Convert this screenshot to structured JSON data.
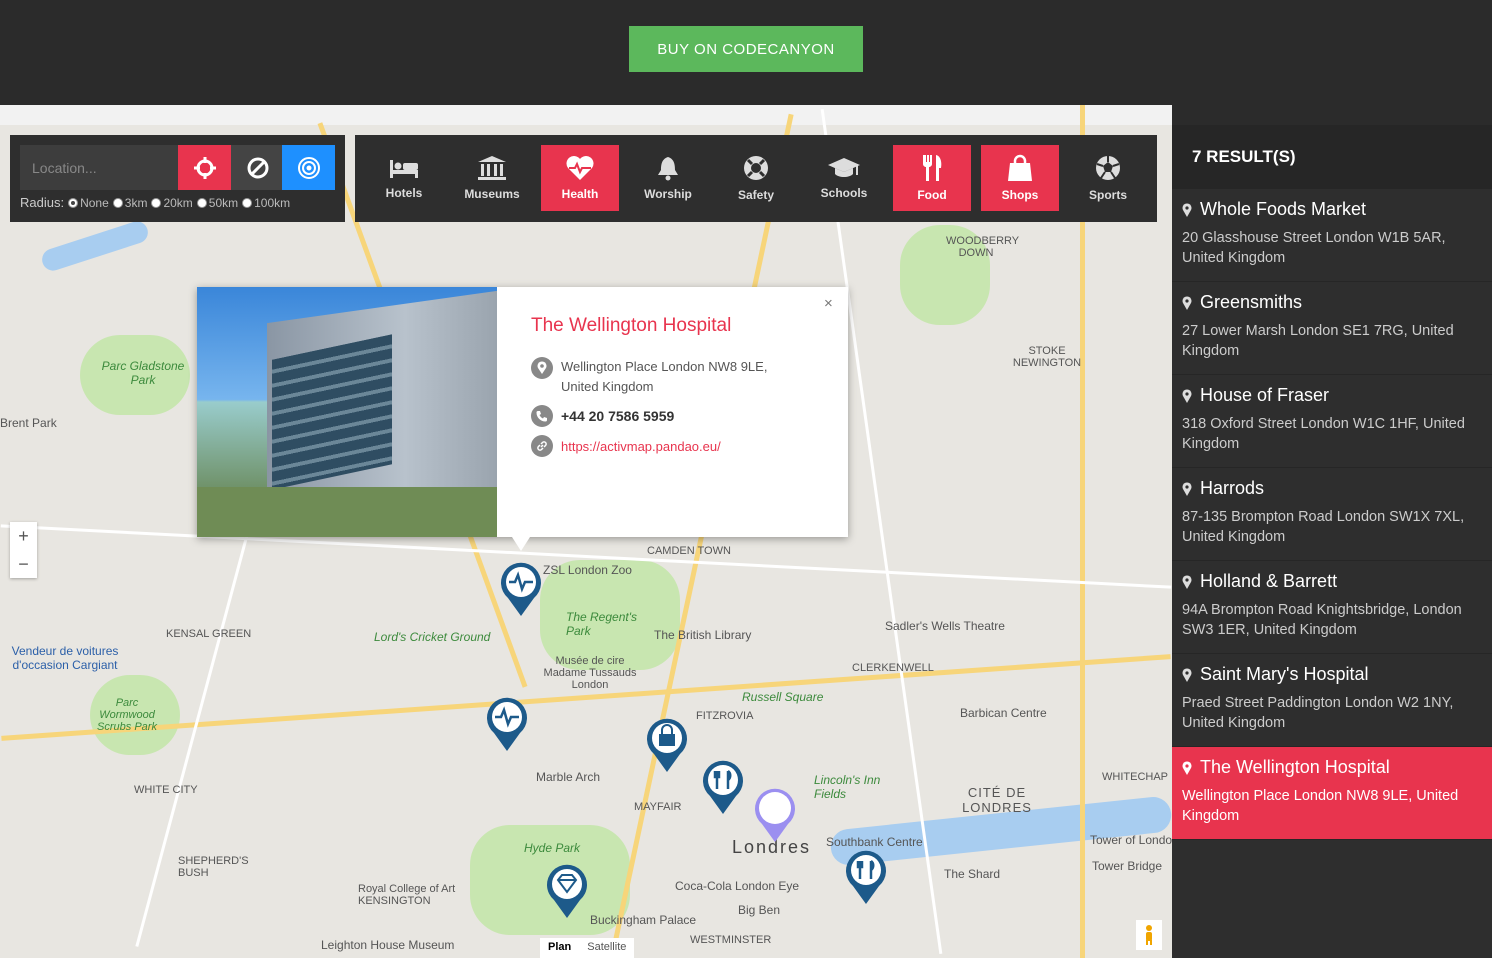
{
  "header": {
    "buy_label": "BUY ON CODECANYON"
  },
  "location": {
    "placeholder": "Location...",
    "radius_label": "Radius:",
    "radius_options": [
      "None",
      "3km",
      "20km",
      "50km",
      "100km"
    ]
  },
  "categories": [
    {
      "label": "Hotels",
      "icon": "bed-icon",
      "active": false
    },
    {
      "label": "Museums",
      "icon": "museum-icon",
      "active": false
    },
    {
      "label": "Health",
      "icon": "heartbeat-icon",
      "active": true
    },
    {
      "label": "Worship",
      "icon": "bell-icon",
      "active": false
    },
    {
      "label": "Safety",
      "icon": "lifebuoy-icon",
      "active": false
    },
    {
      "label": "Schools",
      "icon": "graduation-cap-icon",
      "active": false
    },
    {
      "label": "Food",
      "icon": "cutlery-icon",
      "active": true
    },
    {
      "label": "Shops",
      "icon": "shopping-bag-icon",
      "active": true
    },
    {
      "label": "Sports",
      "icon": "soccer-ball-icon",
      "active": false
    }
  ],
  "colors": {
    "accent": "#e8344e",
    "blue": "#1e90ff",
    "green": "#5cb85c",
    "marker": "#1d5a8a"
  },
  "infowindow": {
    "title": "The Wellington Hospital",
    "address_line1": "Wellington Place London NW8 9LE,",
    "address_line2": "United Kingdom",
    "phone": "+44 20 7586 5959",
    "url": "https://activmap.pandao.eu/",
    "close": "×"
  },
  "map": {
    "zoom_in": "+",
    "zoom_out": "−",
    "type_plan": "Plan",
    "type_satellite": "Satellite",
    "labels": {
      "london": "Londres",
      "camden": "CAMDEN TOWN",
      "zoo": "ZSL London Zoo",
      "regents": "The Regent's Park",
      "lords": "Lord's Cricket Ground",
      "library": "The British Library",
      "sadlers": "Sadler's Wells Theatre",
      "clerkenwell": "CLERKENWELL",
      "tussauds": "Musée de cire Madame Tussauds London",
      "fitzrovia": "FITZROVIA",
      "russell": "Russell Square",
      "barbican": "Barbican Centre",
      "marble": "Marble Arch",
      "mayfair": "MAYFAIR",
      "hyde": "Hyde Park",
      "kensington": "Royal College of Art KENSINGTON",
      "buckingham": "Buckingham Palace",
      "bigben": "Big Ben",
      "westminster": "WESTMINSTER",
      "southbank": "Southbank Centre",
      "shard": "The Shard",
      "cite": "CITÉ DE LONDRES",
      "tower": "Tower of London",
      "towerbridge": "Tower Bridge",
      "kensal": "KENSAL GREEN",
      "whitecity": "WHITE CITY",
      "shepherds": "SHEPHERD'S BUSH",
      "gladstone": "Parc Gladstone Park",
      "wormwood": "Parc Wormwood Scrubs Park",
      "stoke": "STOKE NEWINGTON",
      "woodberry": "WOODBERRY DOWN",
      "leighton": "Leighton House Museum",
      "cocacola": "Coca-Cola London Eye",
      "vendeur": "Vendeur de voitures d'occasion Cargiant",
      "brent": "Brent Park",
      "lincoln": "Lincoln's Inn Fields",
      "whitechapel": "WHITECHAP"
    }
  },
  "results": {
    "count_label": "7 RESULT(S)",
    "items": [
      {
        "name": "Whole Foods Market",
        "address": "20 Glasshouse Street London W1B 5AR, United Kingdom",
        "active": false
      },
      {
        "name": "Greensmiths",
        "address": "27 Lower Marsh London SE1 7RG, United Kingdom",
        "active": false
      },
      {
        "name": "House of Fraser",
        "address": "318 Oxford Street London W1C 1HF, United Kingdom",
        "active": false
      },
      {
        "name": "Harrods",
        "address": "87-135 Brompton Road London SW1X 7XL, United Kingdom",
        "active": false
      },
      {
        "name": "Holland & Barrett",
        "address": "94A Brompton Road Knightsbridge, London SW3 1ER, United Kingdom",
        "active": false
      },
      {
        "name": "Saint Mary's Hospital",
        "address": "Praed Street Paddington London W2 1NY, United Kingdom",
        "active": false
      },
      {
        "name": "The Wellington Hospital",
        "address": "Wellington Place London NW8 9LE, United Kingdom",
        "active": true
      }
    ]
  }
}
